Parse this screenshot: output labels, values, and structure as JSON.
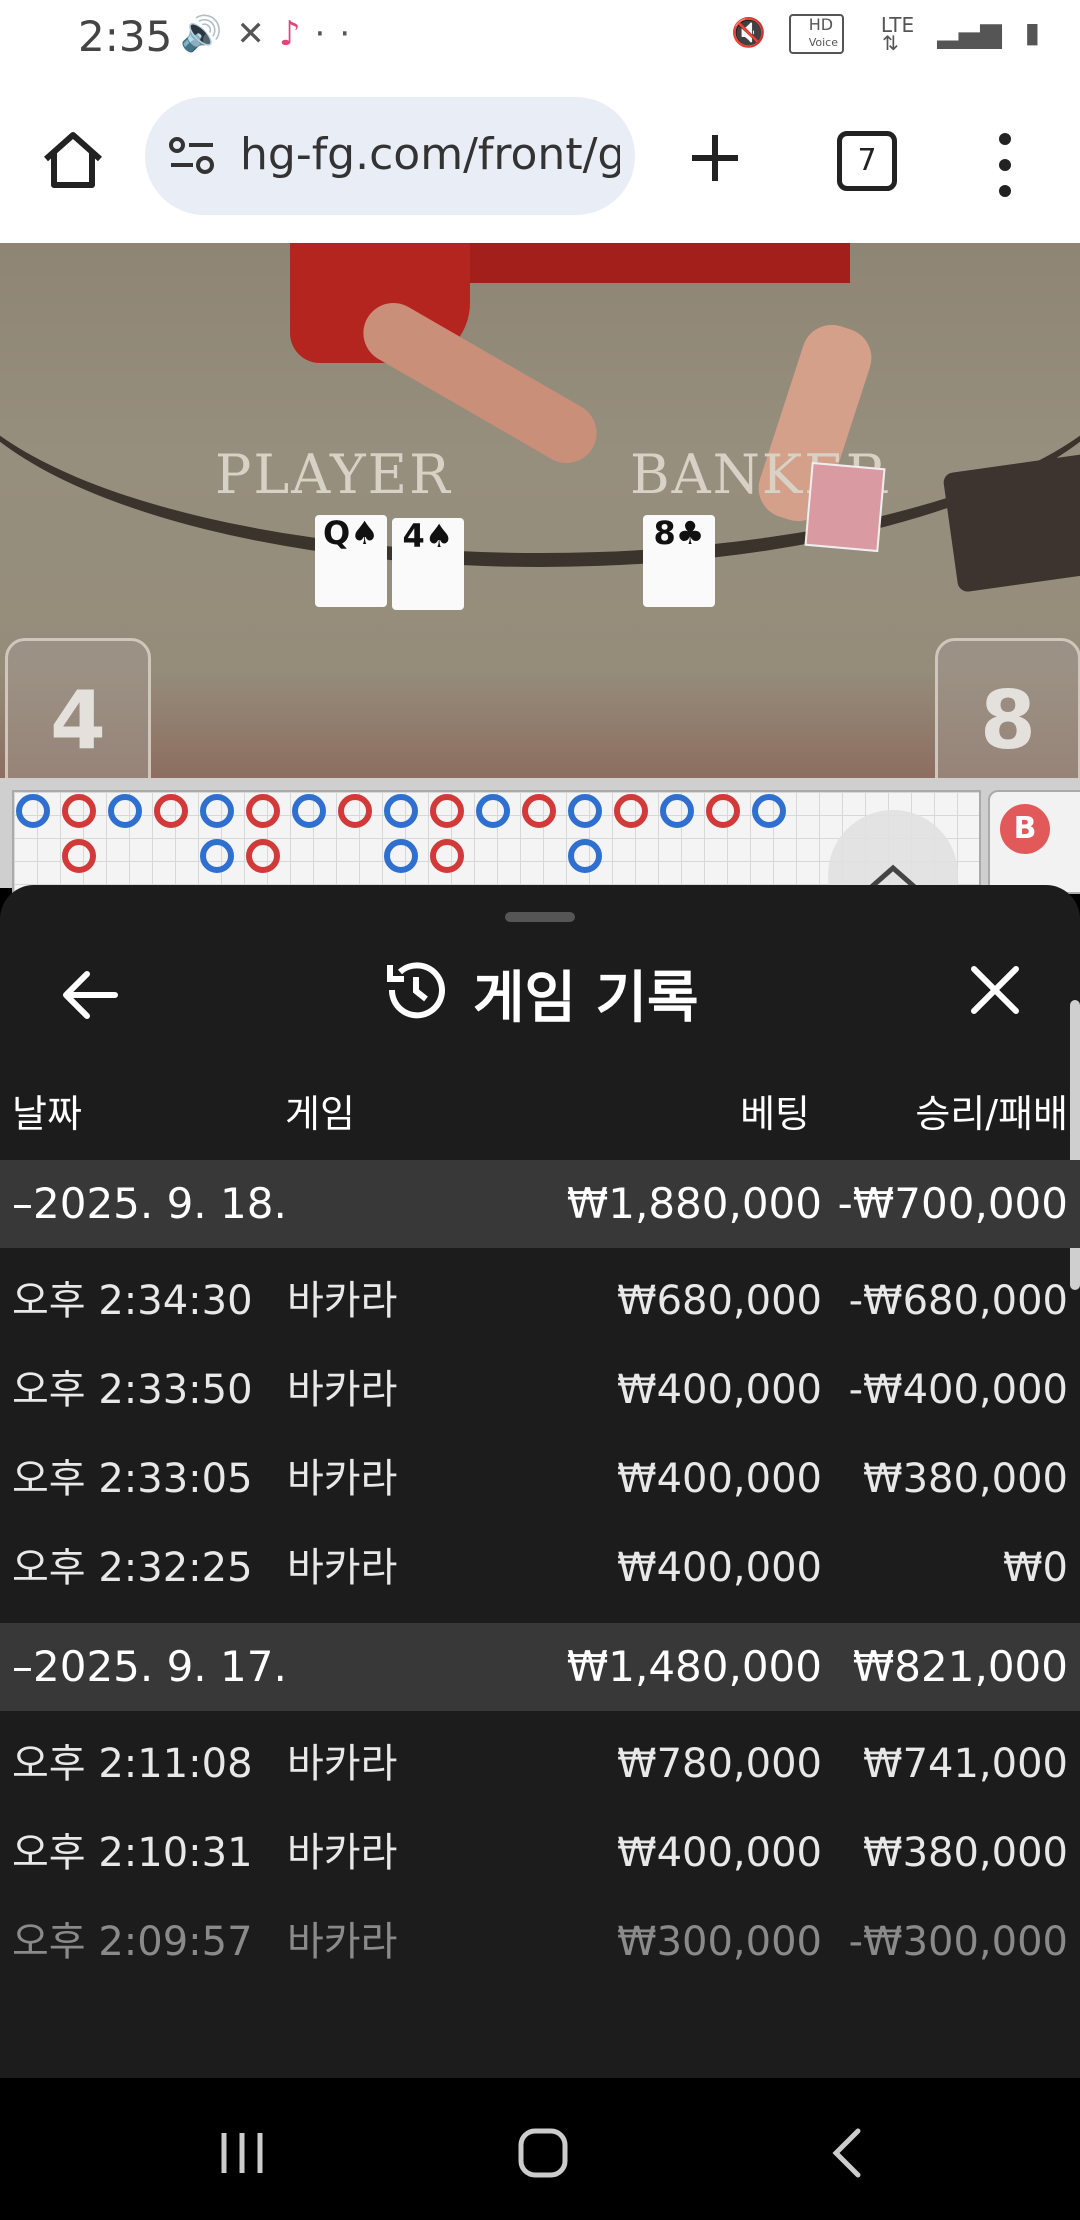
{
  "status_bar": {
    "time": "2:35",
    "left_icons": [
      "volume-icon",
      "missed-call-icon",
      "tiktok-icon",
      "more-dots-icon"
    ],
    "right_icons": [
      "mute-icon",
      "hd-voice-icon",
      "lte-icon",
      "signal-icon",
      "battery-icon"
    ],
    "hd_label": "HD",
    "voice_label": "Voice",
    "lte_label": "LTE"
  },
  "browser": {
    "url": "hg-fg.com/front/g",
    "tab_count": "7"
  },
  "video": {
    "player_label": "PLAYER",
    "banker_label": "BANKER",
    "player_score": "4",
    "banker_score": "8",
    "player_cards": [
      "Q♠",
      "4♠"
    ],
    "banker_cards": [
      "8♣"
    ]
  },
  "bead_road": {
    "top_row": [
      "b",
      "r",
      "b",
      "r",
      "b",
      "r",
      "b",
      "r",
      "b",
      "r",
      "b",
      "r",
      "b",
      "r",
      "b",
      "r",
      "b"
    ],
    "bottom_row": [
      null,
      "r",
      null,
      null,
      "b",
      "r",
      null,
      null,
      "b",
      "r",
      null,
      null,
      "b",
      null,
      null,
      null,
      null
    ],
    "side_label": "B"
  },
  "sheet": {
    "title": "게임 기록",
    "columns": {
      "date": "날짜",
      "game": "게임",
      "bet": "베팅",
      "result": "승리/패배"
    },
    "groups": [
      {
        "date": "–2025. 9. 18.",
        "bet": "₩1,880,000",
        "result": "-₩700,000",
        "rows": [
          {
            "time": "오후 2:34:30",
            "game": "바카라",
            "bet": "₩680,000",
            "result": "-₩680,000"
          },
          {
            "time": "오후 2:33:50",
            "game": "바카라",
            "bet": "₩400,000",
            "result": "-₩400,000"
          },
          {
            "time": "오후 2:33:05",
            "game": "바카라",
            "bet": "₩400,000",
            "result": "₩380,000"
          },
          {
            "time": "오후 2:32:25",
            "game": "바카라",
            "bet": "₩400,000",
            "result": "₩0"
          }
        ]
      },
      {
        "date": "–2025. 9. 17.",
        "bet": "₩1,480,000",
        "result": "₩821,000",
        "rows": [
          {
            "time": "오후 2:11:08",
            "game": "바카라",
            "bet": "₩780,000",
            "result": "₩741,000"
          },
          {
            "time": "오후 2:10:31",
            "game": "바카라",
            "bet": "₩400,000",
            "result": "₩380,000"
          },
          {
            "time": "오후 2:09:57",
            "game": "바카라",
            "bet": "₩300,000",
            "result": "-₩300,000"
          }
        ]
      }
    ]
  },
  "colors": {
    "banker_blue": "#2e6fd0",
    "player_red": "#d23a3a",
    "sheet_bg": "#1c1c1c",
    "group_row_bg": "#383838"
  }
}
